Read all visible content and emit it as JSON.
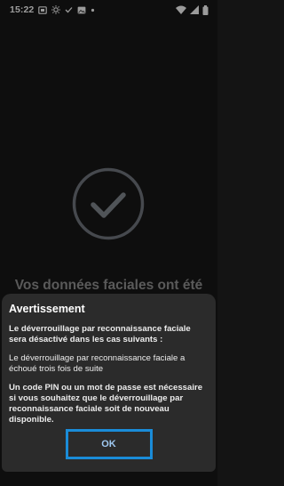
{
  "status_bar": {
    "time": "15:22",
    "icons": [
      "screen-record-icon",
      "settings-brightness-icon",
      "check-icon",
      "image-icon",
      "dot-icon",
      "wifi-icon",
      "signal-icon",
      "battery-icon"
    ]
  },
  "background": {
    "title": "Vos données faciales ont été",
    "check_icon": "check-circle-icon"
  },
  "dialog": {
    "title": "Avertissement",
    "intro": "Le déverrouillage par reconnaissance faciale sera désactivé dans les cas suivants :",
    "condition": "Le déverrouillage par reconnaissance faciale a échoué trois fois de suite",
    "note": "Un code PIN ou un mot de passe est nécessaire si vous souhaitez que le déverrouillage par reconnaissance faciale soit de nouveau disponible.",
    "ok_label": "OK"
  },
  "colors": {
    "background": "#161616",
    "dialog": "#2b2b2b",
    "highlight": "#1a8cd8",
    "button_text": "#9fc9f2"
  }
}
